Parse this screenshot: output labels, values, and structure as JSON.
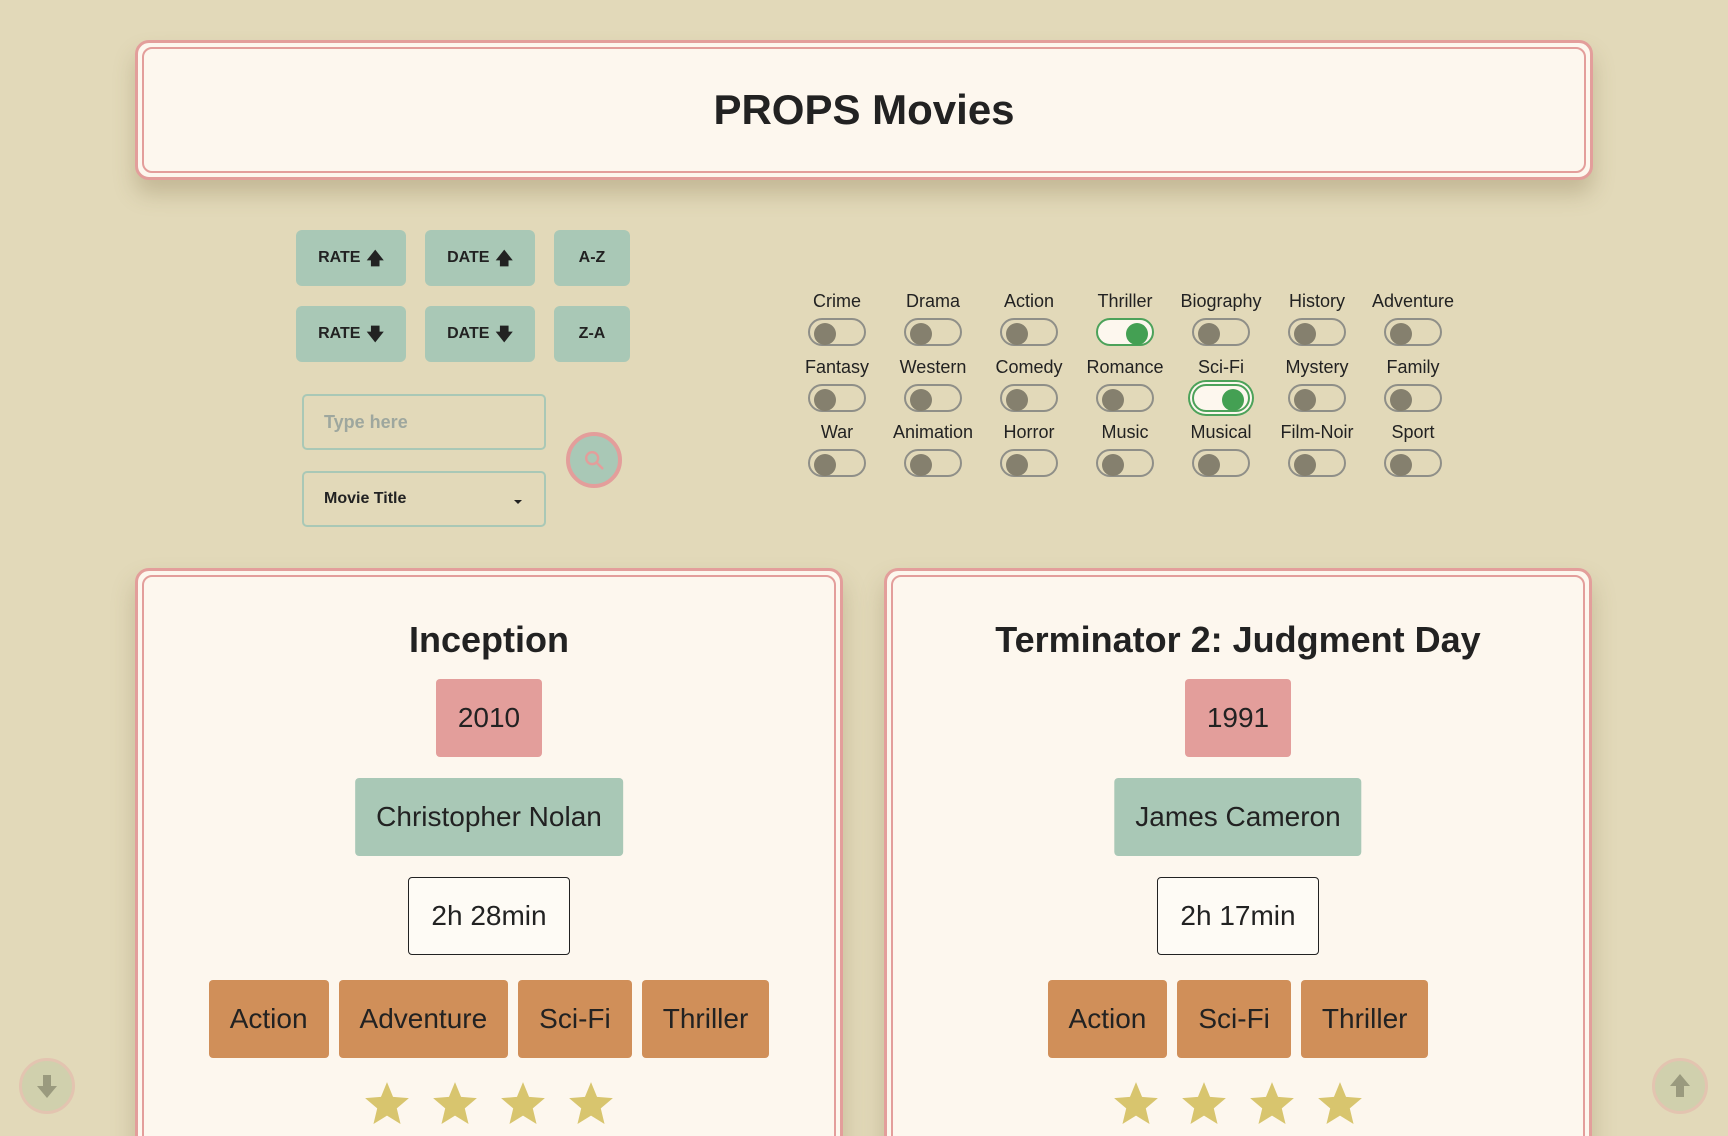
{
  "header": {
    "title": "PROPS Movies"
  },
  "sort": {
    "rate_up": "RATE",
    "date_up": "DATE",
    "az": "A-Z",
    "rate_down": "RATE",
    "date_down": "DATE",
    "za": "Z-A"
  },
  "search": {
    "placeholder": "Type here",
    "value": ""
  },
  "search_by": {
    "selected": "Movie Title"
  },
  "genres": [
    {
      "label": "Crime",
      "on": false
    },
    {
      "label": "Drama",
      "on": false
    },
    {
      "label": "Action",
      "on": false
    },
    {
      "label": "Thriller",
      "on": true
    },
    {
      "label": "Biography",
      "on": false
    },
    {
      "label": "History",
      "on": false
    },
    {
      "label": "Adventure",
      "on": false
    },
    {
      "label": "Fantasy",
      "on": false
    },
    {
      "label": "Western",
      "on": false
    },
    {
      "label": "Comedy",
      "on": false
    },
    {
      "label": "Romance",
      "on": false
    },
    {
      "label": "Sci-Fi",
      "on": true
    },
    {
      "label": "Mystery",
      "on": false
    },
    {
      "label": "Family",
      "on": false
    },
    {
      "label": "War",
      "on": false
    },
    {
      "label": "Animation",
      "on": false
    },
    {
      "label": "Horror",
      "on": false
    },
    {
      "label": "Music",
      "on": false
    },
    {
      "label": "Musical",
      "on": false
    },
    {
      "label": "Film-Noir",
      "on": false
    },
    {
      "label": "Sport",
      "on": false
    }
  ],
  "movies": [
    {
      "title": "Inception",
      "year": "2010",
      "director": "Christopher Nolan",
      "runtime": "2h 28min",
      "genres": [
        "Action",
        "Adventure",
        "Sci-Fi",
        "Thriller"
      ],
      "stars_visible": 4
    },
    {
      "title": "Terminator 2: Judgment Day",
      "year": "1991",
      "director": "James Cameron",
      "runtime": "2h 17min",
      "genres": [
        "Action",
        "Sci-Fi",
        "Thriller"
      ],
      "stars_visible": 4
    }
  ],
  "colors": {
    "background": "#e2d9b9",
    "accent_pink": "#e39e9b",
    "accent_green": "#a9c8b6",
    "genre_orange": "#d08f59",
    "star_yellow": "#d8c56e",
    "toggle_on": "#44a053"
  },
  "icons": {
    "sort_up": "arrow-up-icon",
    "sort_down": "arrow-down-icon",
    "search": "search-icon",
    "dropdown": "caret-down-icon",
    "rating": "star-icon",
    "scroll_down": "scroll-down-icon",
    "scroll_up": "scroll-up-icon"
  }
}
